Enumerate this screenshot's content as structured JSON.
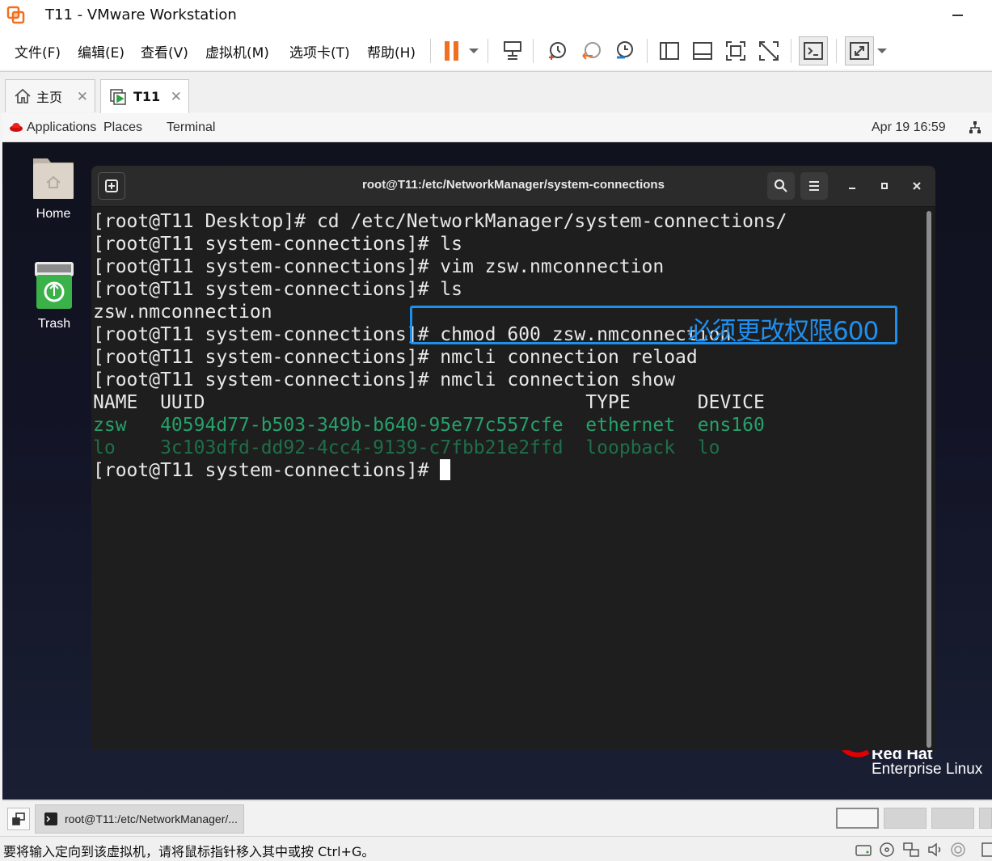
{
  "window": {
    "title": "T11 - VMware Workstation"
  },
  "menu": {
    "file": "文件(F)",
    "edit": "编辑(E)",
    "view": "查看(V)",
    "vm": "虚拟机(M)",
    "tabs": "选项卡(T)",
    "help": "帮助(H)"
  },
  "tabs": [
    {
      "label": "主页"
    },
    {
      "label": "T11"
    }
  ],
  "gnome": {
    "applications": "Applications",
    "places": "Places",
    "terminal": "Terminal",
    "datetime": "Apr 19  16:59"
  },
  "desktop": {
    "home_label": "Home",
    "trash_label": "Trash",
    "brand_line1": "Red Hat",
    "brand_line2": "Enterprise Linux"
  },
  "terminal": {
    "title": "root@T11:/etc/NetworkManager/system-connections",
    "lines": [
      "[root@T11 Desktop]# cd /etc/NetworkManager/system-connections/",
      "[root@T11 system-connections]# ls",
      "[root@T11 system-connections]# vim zsw.nmconnection",
      "[root@T11 system-connections]# ls",
      "zsw.nmconnection",
      "[root@T11 system-connections]# chmod 600 zsw.nmconnection",
      "[root@T11 system-connections]# nmcli connection reload",
      "[root@T11 system-connections]# nmcli connection show",
      "NAME  UUID                                  TYPE      DEVICE",
      "zsw   40594d77-b503-349b-b640-95e77c557cfe  ethernet  ens160",
      "lo    3c103dfd-dd92-4cc4-9139-c7fbb21e2ffd  loopback  lo",
      "[root@T11 system-connections]# "
    ],
    "annotation": "必须更改权限600"
  },
  "taskbar": {
    "task_label": "root@T11:/etc/NetworkManager/..."
  },
  "statusbar": {
    "message": "要将输入定向到该虚拟机，请将鼠标指针移入其中或按 Ctrl+G。"
  },
  "colors": {
    "accent_annotation": "#1f8fee",
    "pause_orange": "#f07020",
    "terminal_bg": "#1e1e1e",
    "active_connection": "#27a06a",
    "inactive_connection": "#1f6e4a",
    "redhat_red": "#ee0000"
  }
}
